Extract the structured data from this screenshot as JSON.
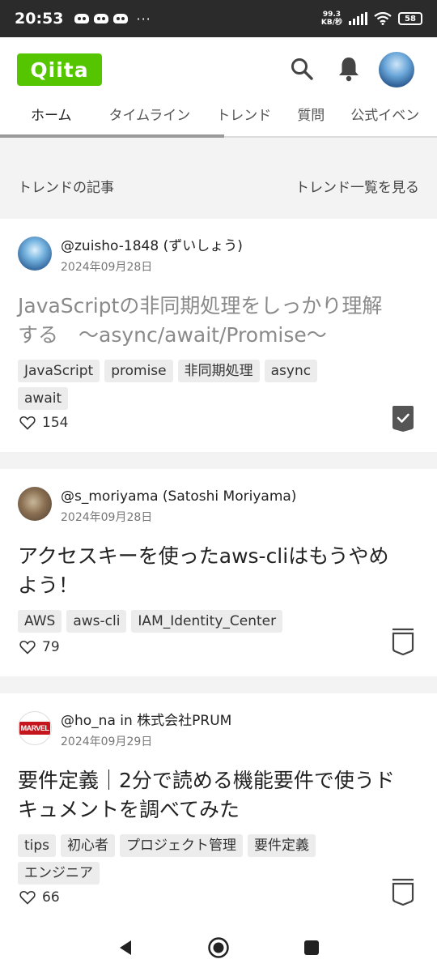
{
  "status_bar": {
    "time": "20:53",
    "notif_icons": [
      "game-controller-icon",
      "game-controller-icon",
      "game-controller-icon"
    ],
    "more": "···",
    "net_speed_value": "99.3",
    "net_speed_unit": "KB/秒",
    "battery": "58"
  },
  "header": {
    "logo": "Qiita",
    "tabs": [
      "ホーム",
      "タイムライン",
      "トレンド",
      "質問",
      "公式イベン"
    ],
    "active_tab": "ホーム"
  },
  "section": {
    "title": "トレンドの記事",
    "more_link": "トレンド一覧を見る"
  },
  "articles": [
    {
      "author": "@zuisho-1848 (ずいしょう)",
      "date": "2024年09月28日",
      "title_line1": "JavaScriptの非同期処理をしっかり理解",
      "title_line2": "する　～async/await/Promise～",
      "tags": [
        "JavaScript",
        "promise",
        "非同期処理",
        "async",
        "await"
      ],
      "likes": "154",
      "stocked": true
    },
    {
      "author": "@s_moriyama (Satoshi Moriyama)",
      "date": "2024年09月28日",
      "title_line1": "アクセスキーを使ったaws-cliはもうやめ",
      "title_line2": "よう！",
      "tags": [
        "AWS",
        "aws-cli",
        "IAM_Identity_Center"
      ],
      "likes": "79",
      "stocked": false
    },
    {
      "author": "@ho_na in 株式会社PRUM",
      "date": "2024年09月29日",
      "avatar_text": "MARVEL",
      "title_line1": "要件定義｜2分で読める機能要件で使うド",
      "title_line2": "キュメントを調べてみた",
      "tags": [
        "tips",
        "初心者",
        "プロジェクト管理",
        "要件定義",
        "エンジニア"
      ],
      "likes": "66",
      "stocked": false
    }
  ],
  "colors": {
    "brand": "#55c500",
    "visited_title": "#8a8a8a",
    "background": "#f3f3f3"
  }
}
